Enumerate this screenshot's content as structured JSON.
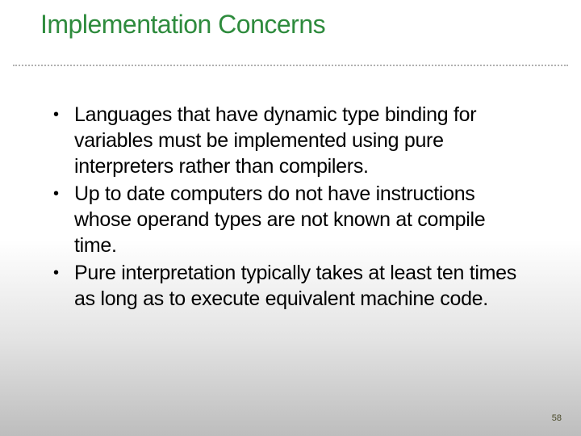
{
  "slide": {
    "title": "Implementation Concerns",
    "bullets": [
      "Languages that have dynamic type binding for variables must be implemented using pure interpreters rather than compilers.",
      "Up to date computers do not have instructions whose operand types are not known at compile time.",
      "Pure interpretation typically takes at least ten times as long as to execute equivalent machine code."
    ],
    "page_number": "58"
  }
}
